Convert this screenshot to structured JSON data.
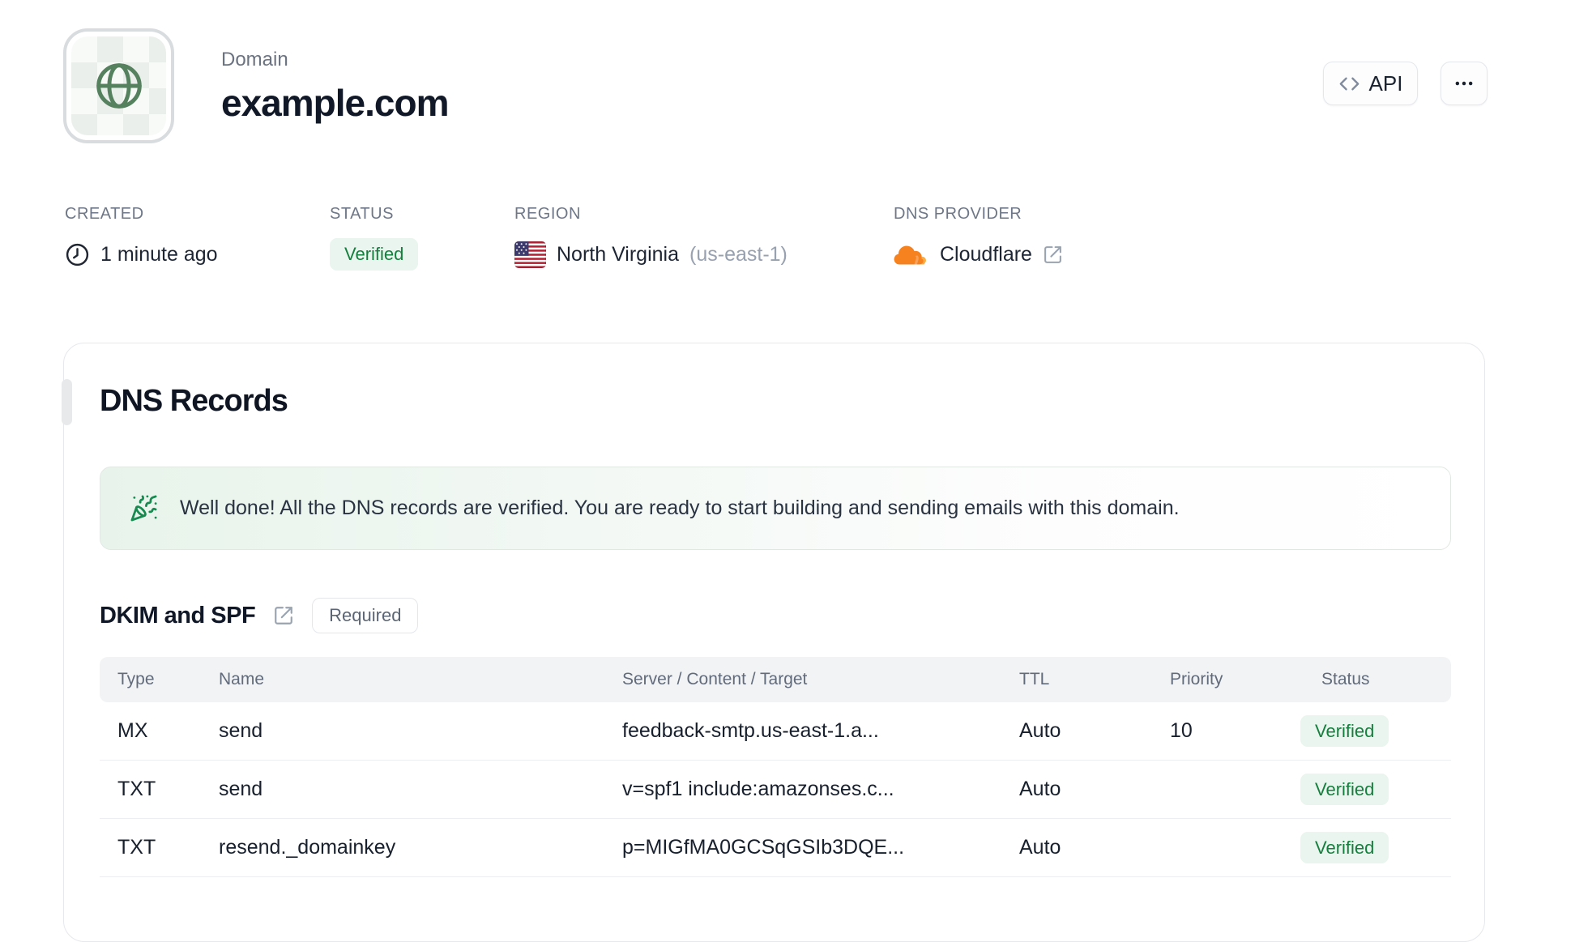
{
  "header": {
    "label": "Domain",
    "title": "example.com",
    "api_button": "API"
  },
  "meta": {
    "created": {
      "label": "CREATED",
      "value": "1 minute ago"
    },
    "status": {
      "label": "STATUS",
      "value": "Verified"
    },
    "region": {
      "label": "REGION",
      "value": "North Virginia",
      "code": "(us-east-1)"
    },
    "dns_provider": {
      "label": "DNS PROVIDER",
      "value": "Cloudflare"
    }
  },
  "dns_card": {
    "title": "DNS Records",
    "banner": "Well done! All the DNS records are verified. You are ready to start building and sending emails with this domain.",
    "section": {
      "title": "DKIM and SPF",
      "badge": "Required"
    },
    "table": {
      "headers": [
        "Type",
        "Name",
        "Server / Content / Target",
        "TTL",
        "Priority",
        "Status"
      ],
      "rows": [
        {
          "type": "MX",
          "name": "send",
          "content": "feedback-smtp.us-east-1.a...",
          "ttl": "Auto",
          "priority": "10",
          "status": "Verified"
        },
        {
          "type": "TXT",
          "name": "send",
          "content": "v=spf1 include:amazonses.c...",
          "ttl": "Auto",
          "priority": "",
          "status": "Verified"
        },
        {
          "type": "TXT",
          "name": "resend._domainkey",
          "content": "p=MIGfMA0GCSqGSIb3DQE...",
          "ttl": "Auto",
          "priority": "",
          "status": "Verified"
        }
      ]
    }
  },
  "icons": {
    "app": "globe-icon",
    "created": "clock-icon",
    "region": "us-flag-icon",
    "dns_provider": "cloudflare-icon",
    "banner": "party-popper-icon",
    "links": "external-link-icon",
    "api": "code-icon",
    "more": "ellipsis-icon"
  },
  "colors": {
    "green-text": "#15803d",
    "green-bg": "#e9f5ee",
    "green-icon": "#55815f",
    "cloudflare-orange": "#f6821f",
    "cloudflare-light": "#fbad41",
    "banner-green": "#e8f4eb"
  }
}
